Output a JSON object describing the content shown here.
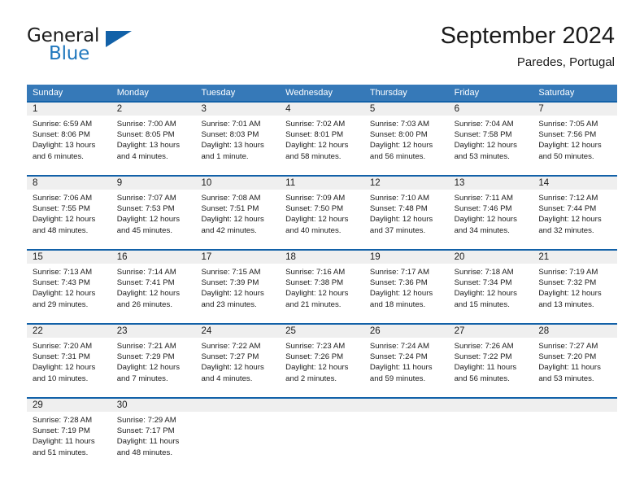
{
  "brand": {
    "name_part1": "General",
    "name_part2": "Blue",
    "triangle_icon": "triangle-icon",
    "accent_color": "#1261a8",
    "blue_text_color": "#1f77bd"
  },
  "header": {
    "month_title": "September 2024",
    "location": "Paredes, Portugal"
  },
  "calendar": {
    "header_bg": "#3679b8",
    "week_separator_color": "#1261a8",
    "day_number_bg": "#efefef",
    "weekdays": [
      "Sunday",
      "Monday",
      "Tuesday",
      "Wednesday",
      "Thursday",
      "Friday",
      "Saturday"
    ],
    "weeks": [
      [
        {
          "day": "1",
          "sunrise": "Sunrise: 6:59 AM",
          "sunset": "Sunset: 8:06 PM",
          "daylight_line1": "Daylight: 13 hours",
          "daylight_line2": "and 6 minutes."
        },
        {
          "day": "2",
          "sunrise": "Sunrise: 7:00 AM",
          "sunset": "Sunset: 8:05 PM",
          "daylight_line1": "Daylight: 13 hours",
          "daylight_line2": "and 4 minutes."
        },
        {
          "day": "3",
          "sunrise": "Sunrise: 7:01 AM",
          "sunset": "Sunset: 8:03 PM",
          "daylight_line1": "Daylight: 13 hours",
          "daylight_line2": "and 1 minute."
        },
        {
          "day": "4",
          "sunrise": "Sunrise: 7:02 AM",
          "sunset": "Sunset: 8:01 PM",
          "daylight_line1": "Daylight: 12 hours",
          "daylight_line2": "and 58 minutes."
        },
        {
          "day": "5",
          "sunrise": "Sunrise: 7:03 AM",
          "sunset": "Sunset: 8:00 PM",
          "daylight_line1": "Daylight: 12 hours",
          "daylight_line2": "and 56 minutes."
        },
        {
          "day": "6",
          "sunrise": "Sunrise: 7:04 AM",
          "sunset": "Sunset: 7:58 PM",
          "daylight_line1": "Daylight: 12 hours",
          "daylight_line2": "and 53 minutes."
        },
        {
          "day": "7",
          "sunrise": "Sunrise: 7:05 AM",
          "sunset": "Sunset: 7:56 PM",
          "daylight_line1": "Daylight: 12 hours",
          "daylight_line2": "and 50 minutes."
        }
      ],
      [
        {
          "day": "8",
          "sunrise": "Sunrise: 7:06 AM",
          "sunset": "Sunset: 7:55 PM",
          "daylight_line1": "Daylight: 12 hours",
          "daylight_line2": "and 48 minutes."
        },
        {
          "day": "9",
          "sunrise": "Sunrise: 7:07 AM",
          "sunset": "Sunset: 7:53 PM",
          "daylight_line1": "Daylight: 12 hours",
          "daylight_line2": "and 45 minutes."
        },
        {
          "day": "10",
          "sunrise": "Sunrise: 7:08 AM",
          "sunset": "Sunset: 7:51 PM",
          "daylight_line1": "Daylight: 12 hours",
          "daylight_line2": "and 42 minutes."
        },
        {
          "day": "11",
          "sunrise": "Sunrise: 7:09 AM",
          "sunset": "Sunset: 7:50 PM",
          "daylight_line1": "Daylight: 12 hours",
          "daylight_line2": "and 40 minutes."
        },
        {
          "day": "12",
          "sunrise": "Sunrise: 7:10 AM",
          "sunset": "Sunset: 7:48 PM",
          "daylight_line1": "Daylight: 12 hours",
          "daylight_line2": "and 37 minutes."
        },
        {
          "day": "13",
          "sunrise": "Sunrise: 7:11 AM",
          "sunset": "Sunset: 7:46 PM",
          "daylight_line1": "Daylight: 12 hours",
          "daylight_line2": "and 34 minutes."
        },
        {
          "day": "14",
          "sunrise": "Sunrise: 7:12 AM",
          "sunset": "Sunset: 7:44 PM",
          "daylight_line1": "Daylight: 12 hours",
          "daylight_line2": "and 32 minutes."
        }
      ],
      [
        {
          "day": "15",
          "sunrise": "Sunrise: 7:13 AM",
          "sunset": "Sunset: 7:43 PM",
          "daylight_line1": "Daylight: 12 hours",
          "daylight_line2": "and 29 minutes."
        },
        {
          "day": "16",
          "sunrise": "Sunrise: 7:14 AM",
          "sunset": "Sunset: 7:41 PM",
          "daylight_line1": "Daylight: 12 hours",
          "daylight_line2": "and 26 minutes."
        },
        {
          "day": "17",
          "sunrise": "Sunrise: 7:15 AM",
          "sunset": "Sunset: 7:39 PM",
          "daylight_line1": "Daylight: 12 hours",
          "daylight_line2": "and 23 minutes."
        },
        {
          "day": "18",
          "sunrise": "Sunrise: 7:16 AM",
          "sunset": "Sunset: 7:38 PM",
          "daylight_line1": "Daylight: 12 hours",
          "daylight_line2": "and 21 minutes."
        },
        {
          "day": "19",
          "sunrise": "Sunrise: 7:17 AM",
          "sunset": "Sunset: 7:36 PM",
          "daylight_line1": "Daylight: 12 hours",
          "daylight_line2": "and 18 minutes."
        },
        {
          "day": "20",
          "sunrise": "Sunrise: 7:18 AM",
          "sunset": "Sunset: 7:34 PM",
          "daylight_line1": "Daylight: 12 hours",
          "daylight_line2": "and 15 minutes."
        },
        {
          "day": "21",
          "sunrise": "Sunrise: 7:19 AM",
          "sunset": "Sunset: 7:32 PM",
          "daylight_line1": "Daylight: 12 hours",
          "daylight_line2": "and 13 minutes."
        }
      ],
      [
        {
          "day": "22",
          "sunrise": "Sunrise: 7:20 AM",
          "sunset": "Sunset: 7:31 PM",
          "daylight_line1": "Daylight: 12 hours",
          "daylight_line2": "and 10 minutes."
        },
        {
          "day": "23",
          "sunrise": "Sunrise: 7:21 AM",
          "sunset": "Sunset: 7:29 PM",
          "daylight_line1": "Daylight: 12 hours",
          "daylight_line2": "and 7 minutes."
        },
        {
          "day": "24",
          "sunrise": "Sunrise: 7:22 AM",
          "sunset": "Sunset: 7:27 PM",
          "daylight_line1": "Daylight: 12 hours",
          "daylight_line2": "and 4 minutes."
        },
        {
          "day": "25",
          "sunrise": "Sunrise: 7:23 AM",
          "sunset": "Sunset: 7:26 PM",
          "daylight_line1": "Daylight: 12 hours",
          "daylight_line2": "and 2 minutes."
        },
        {
          "day": "26",
          "sunrise": "Sunrise: 7:24 AM",
          "sunset": "Sunset: 7:24 PM",
          "daylight_line1": "Daylight: 11 hours",
          "daylight_line2": "and 59 minutes."
        },
        {
          "day": "27",
          "sunrise": "Sunrise: 7:26 AM",
          "sunset": "Sunset: 7:22 PM",
          "daylight_line1": "Daylight: 11 hours",
          "daylight_line2": "and 56 minutes."
        },
        {
          "day": "28",
          "sunrise": "Sunrise: 7:27 AM",
          "sunset": "Sunset: 7:20 PM",
          "daylight_line1": "Daylight: 11 hours",
          "daylight_line2": "and 53 minutes."
        }
      ],
      [
        {
          "day": "29",
          "sunrise": "Sunrise: 7:28 AM",
          "sunset": "Sunset: 7:19 PM",
          "daylight_line1": "Daylight: 11 hours",
          "daylight_line2": "and 51 minutes."
        },
        {
          "day": "30",
          "sunrise": "Sunrise: 7:29 AM",
          "sunset": "Sunset: 7:17 PM",
          "daylight_line1": "Daylight: 11 hours",
          "daylight_line2": "and 48 minutes."
        },
        {
          "day": "",
          "sunrise": "",
          "sunset": "",
          "daylight_line1": "",
          "daylight_line2": ""
        },
        {
          "day": "",
          "sunrise": "",
          "sunset": "",
          "daylight_line1": "",
          "daylight_line2": ""
        },
        {
          "day": "",
          "sunrise": "",
          "sunset": "",
          "daylight_line1": "",
          "daylight_line2": ""
        },
        {
          "day": "",
          "sunrise": "",
          "sunset": "",
          "daylight_line1": "",
          "daylight_line2": ""
        },
        {
          "day": "",
          "sunrise": "",
          "sunset": "",
          "daylight_line1": "",
          "daylight_line2": ""
        }
      ]
    ]
  }
}
